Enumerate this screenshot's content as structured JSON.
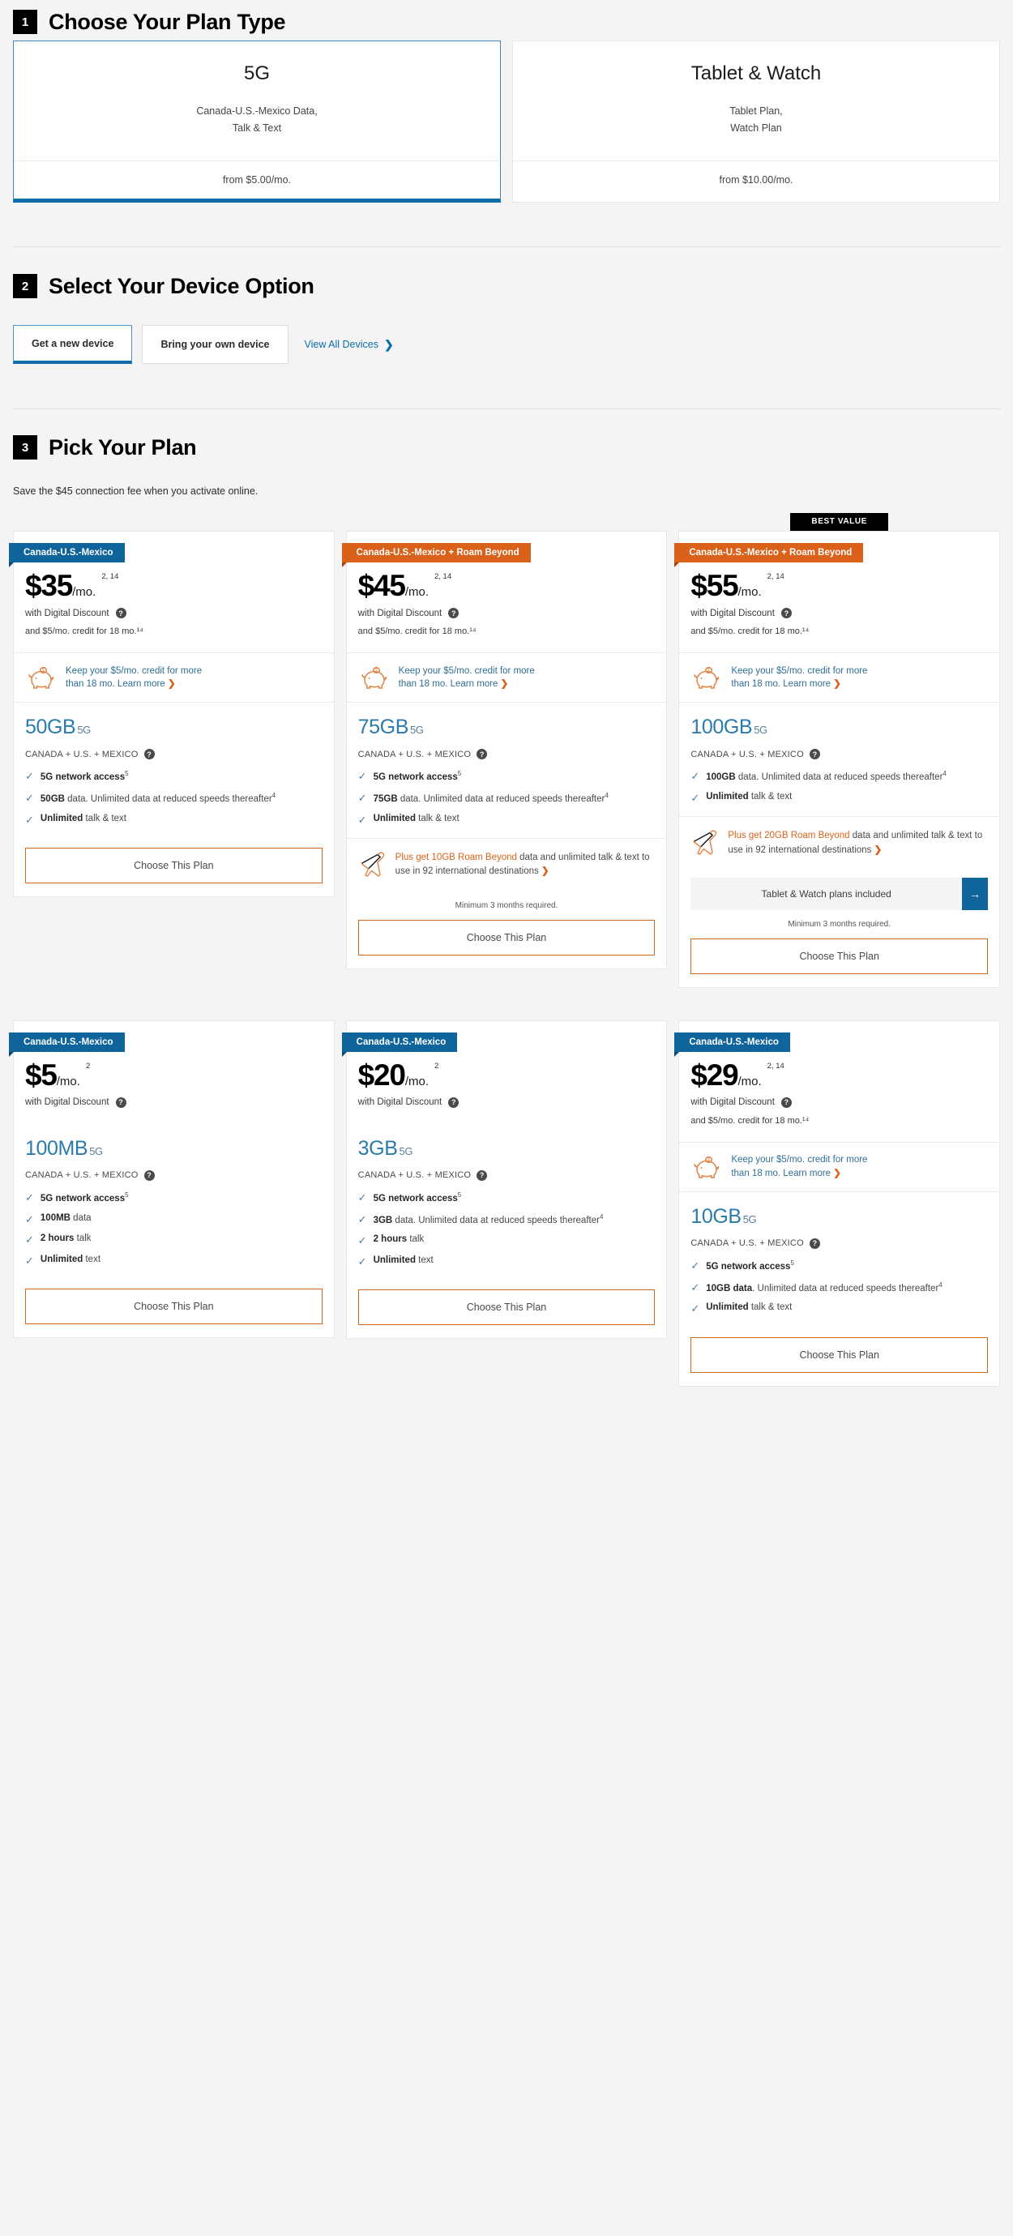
{
  "sections": {
    "one": {
      "num": "1",
      "title": "Choose Your Plan Type"
    },
    "two": {
      "num": "2",
      "title": "Select Your Device Option"
    },
    "three": {
      "num": "3",
      "title": "Pick Your Plan",
      "note": "Save the $45 connection fee when you activate online."
    }
  },
  "plan_types": [
    {
      "name": "5G",
      "desc_line1": "Canada-U.S.-Mexico Data,",
      "desc_line2": "Talk & Text",
      "from": "from $5.00/mo.",
      "selected": true
    },
    {
      "name": "Tablet & Watch",
      "desc_line1": "Tablet Plan,",
      "desc_line2": "Watch Plan",
      "from": "from $10.00/mo.",
      "selected": false
    }
  ],
  "device_options": {
    "buttons": [
      {
        "label": "Get a new device",
        "selected": true
      },
      {
        "label": "Bring your own device",
        "selected": false
      }
    ],
    "view_all": "View All Devices",
    "chevron": "chevron-right-icon"
  },
  "labels": {
    "best_value": "BEST VALUE",
    "with_digital_discount": "with Digital Discount",
    "help_icon": "?",
    "tick_icon": "✓",
    "arrow_right": "›",
    "tw_included": "Tablet & Watch plans included",
    "tw_arrow": "→",
    "min_months": "Minimum 3 months required.",
    "choose_plan": "Choose This Plan",
    "region": "CANADA + U.S. + MEXICO",
    "five_g": "5G",
    "piggy_line1": "Keep your $5/mo. credit for more",
    "piggy_line2": "than 18 mo. Learn more"
  },
  "plans": [
    {
      "id": "plan-50gb",
      "best_value": false,
      "ribbon": {
        "text": "Canada-U.S.-Mexico",
        "color": "blue"
      },
      "price": "$35",
      "per": "/mo.",
      "sup": "2, 14",
      "credit": "and $5/mo. credit for 18 mo.¹⁴",
      "has_piggy": true,
      "data": "50GB",
      "features": [
        {
          "bold": "5G network access",
          "sup": "5",
          "rest": ""
        },
        {
          "bold": "50GB",
          "sup": "",
          "rest": " data. Unlimited data at reduced speeds thereafter",
          "rest_sup": "4"
        },
        {
          "bold": "Unlimited",
          "sup": "",
          "rest": " talk & text"
        }
      ],
      "roam": null,
      "tablet_watch": false,
      "min_note": false
    },
    {
      "id": "plan-75gb",
      "best_value": false,
      "ribbon": {
        "text": "Canada-U.S.-Mexico + Roam Beyond",
        "color": "orange"
      },
      "price": "$45",
      "per": "/mo.",
      "sup": "2, 14",
      "credit": "and $5/mo. credit for 18 mo.¹⁴",
      "has_piggy": true,
      "data": "75GB",
      "features": [
        {
          "bold": "5G network access",
          "sup": "5",
          "rest": ""
        },
        {
          "bold": "75GB",
          "sup": "",
          "rest": " data. Unlimited data at reduced speeds thereafter",
          "rest_sup": "4"
        },
        {
          "bold": "Unlimited",
          "sup": "",
          "rest": " talk & text"
        }
      ],
      "roam": {
        "hl": "Plus get 10GB Roam Beyond",
        "rest": " data and unlimited talk & text to use in 92 international destinations"
      },
      "tablet_watch": false,
      "min_note": true
    },
    {
      "id": "plan-100gb",
      "best_value": true,
      "ribbon": {
        "text": "Canada-U.S.-Mexico + Roam Beyond",
        "color": "orange"
      },
      "price": "$55",
      "per": "/mo.",
      "sup": "2, 14",
      "credit": "and $5/mo. credit for 18 mo.¹⁴",
      "has_piggy": true,
      "data": "100GB",
      "features": [
        {
          "bold": "100GB",
          "sup": "",
          "rest": " data. Unlimited data at reduced speeds thereafter",
          "rest_sup": "4"
        },
        {
          "bold": "Unlimited",
          "sup": "",
          "rest": " talk & text"
        }
      ],
      "roam": {
        "hl": "Plus get 20GB Roam Beyond",
        "rest": " data and unlimited talk & text to use in 92 international destinations"
      },
      "tablet_watch": true,
      "min_note": true
    },
    {
      "id": "plan-100mb",
      "best_value": false,
      "ribbon": {
        "text": "Canada-U.S.-Mexico",
        "color": "blue"
      },
      "price": "$5",
      "per": "/mo.",
      "sup": "2",
      "credit": null,
      "has_piggy": false,
      "data": "100MB",
      "features": [
        {
          "bold": "5G network access",
          "sup": "5",
          "rest": ""
        },
        {
          "bold": "100MB",
          "sup": "",
          "rest": " data"
        },
        {
          "bold": "2 hours",
          "sup": "",
          "rest": " talk"
        },
        {
          "bold": "Unlimited",
          "sup": "",
          "rest": " text"
        }
      ],
      "roam": null,
      "tablet_watch": false,
      "min_note": false
    },
    {
      "id": "plan-3gb",
      "best_value": false,
      "ribbon": {
        "text": "Canada-U.S.-Mexico",
        "color": "blue"
      },
      "price": "$20",
      "per": "/mo.",
      "sup": "2",
      "credit": null,
      "has_piggy": false,
      "data": "3GB",
      "features": [
        {
          "bold": "5G network access",
          "sup": "5",
          "rest": ""
        },
        {
          "bold": "3GB",
          "sup": "",
          "rest": " data. Unlimited data at reduced speeds thereafter",
          "rest_sup": "4"
        },
        {
          "bold": "2 hours",
          "sup": "",
          "rest": " talk"
        },
        {
          "bold": "Unlimited",
          "sup": "",
          "rest": " text"
        }
      ],
      "roam": null,
      "tablet_watch": false,
      "min_note": false
    },
    {
      "id": "plan-10gb",
      "best_value": false,
      "ribbon": {
        "text": "Canada-U.S.-Mexico",
        "color": "blue"
      },
      "price": "$29",
      "per": "/mo.",
      "sup": "2, 14",
      "credit": "and $5/mo. credit for 18 mo.¹⁴",
      "has_piggy": true,
      "data": "10GB",
      "features": [
        {
          "bold": "5G network access",
          "sup": "5",
          "rest": ""
        },
        {
          "bold": "10GB data",
          "sup": "",
          "rest": ". Unlimited data at reduced speeds thereafter",
          "rest_sup": "4"
        },
        {
          "bold": "Unlimited",
          "sup": "",
          "rest": " talk & text"
        }
      ],
      "roam": null,
      "tablet_watch": false,
      "min_note": false
    }
  ]
}
